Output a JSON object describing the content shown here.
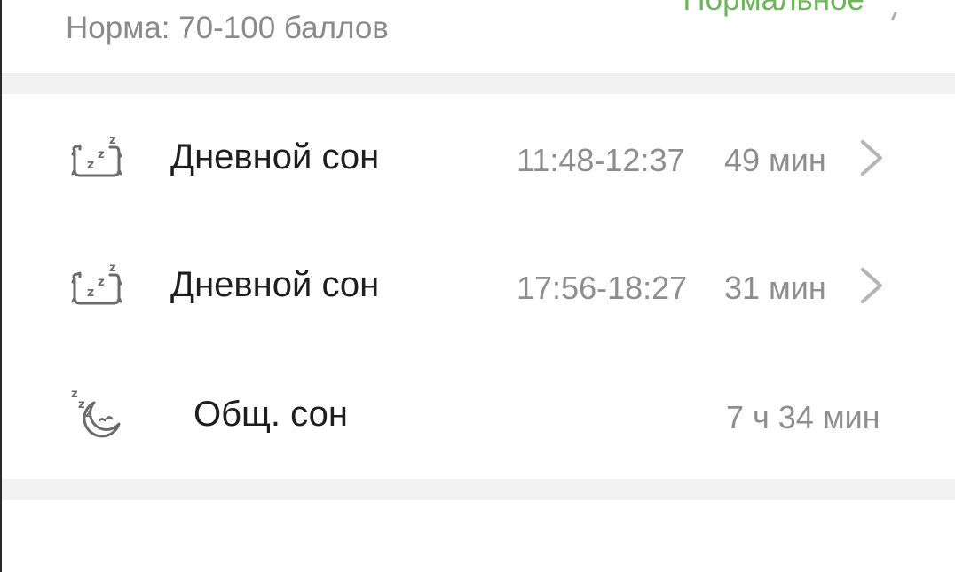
{
  "summary": {
    "norm_label": "Норма: 70-100 баллов",
    "status": "Нормальное",
    "status_color": "#6cb55a"
  },
  "sleep_items": [
    {
      "icon": "nap-pillow-icon",
      "title": "Дневной сон",
      "time_range": "11:48-12:37",
      "duration": "49 мин"
    },
    {
      "icon": "nap-pillow-icon",
      "title": "Дневной сон",
      "time_range": "17:56-18:27",
      "duration": "31 мин"
    }
  ],
  "total": {
    "icon": "moon-sleep-icon",
    "title": "Общ. сон",
    "duration": "7 ч 34 мин"
  },
  "colors": {
    "primary_text": "#1e1e1e",
    "secondary_text": "#8e8e8e",
    "divider": "#f1f1f1",
    "chevron": "#b5b5b5"
  }
}
